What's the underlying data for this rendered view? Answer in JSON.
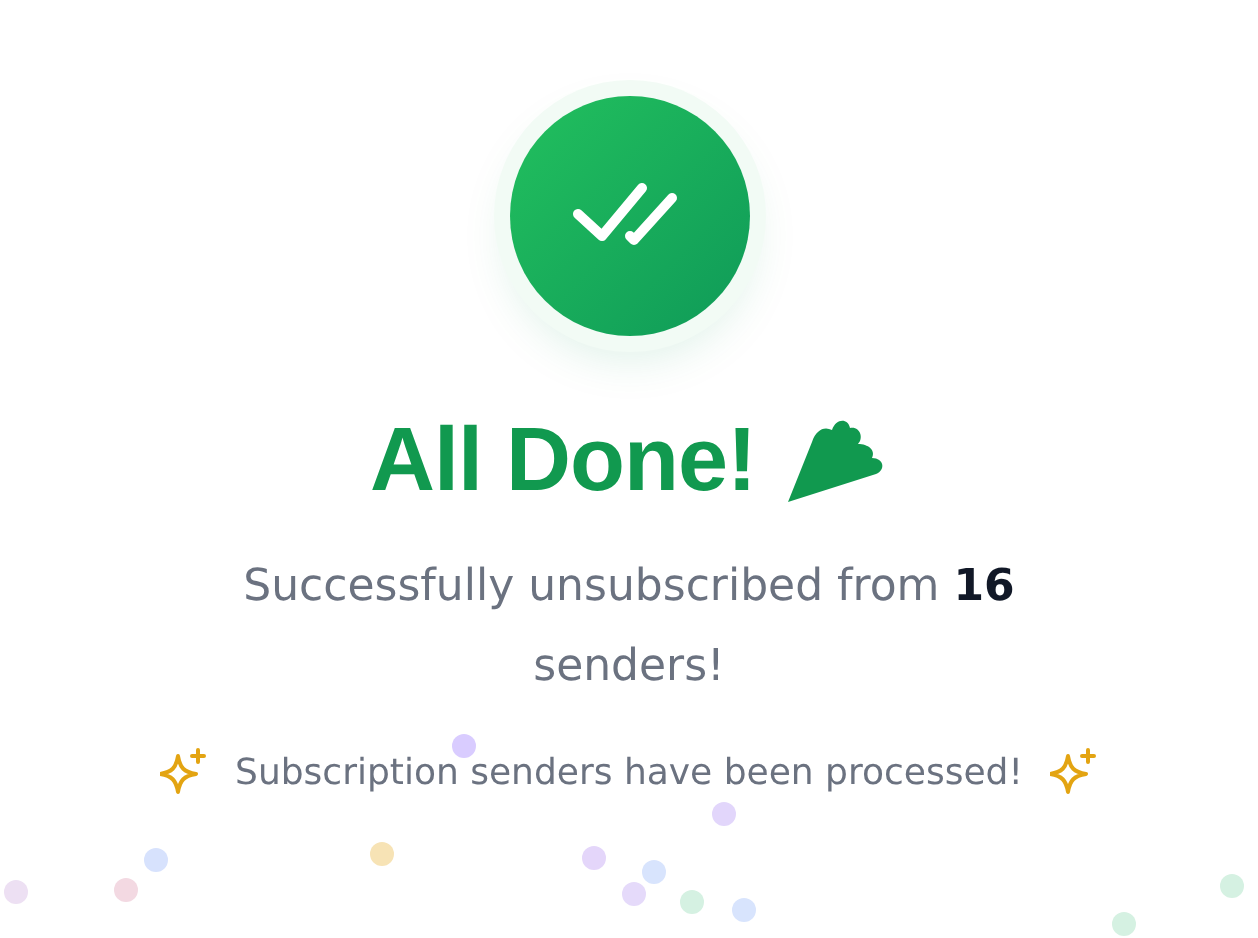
{
  "title": "All Done!",
  "message": "Successfully unsubscribed from **16** senders!",
  "note": "Subscription senders have been processed!"
}
